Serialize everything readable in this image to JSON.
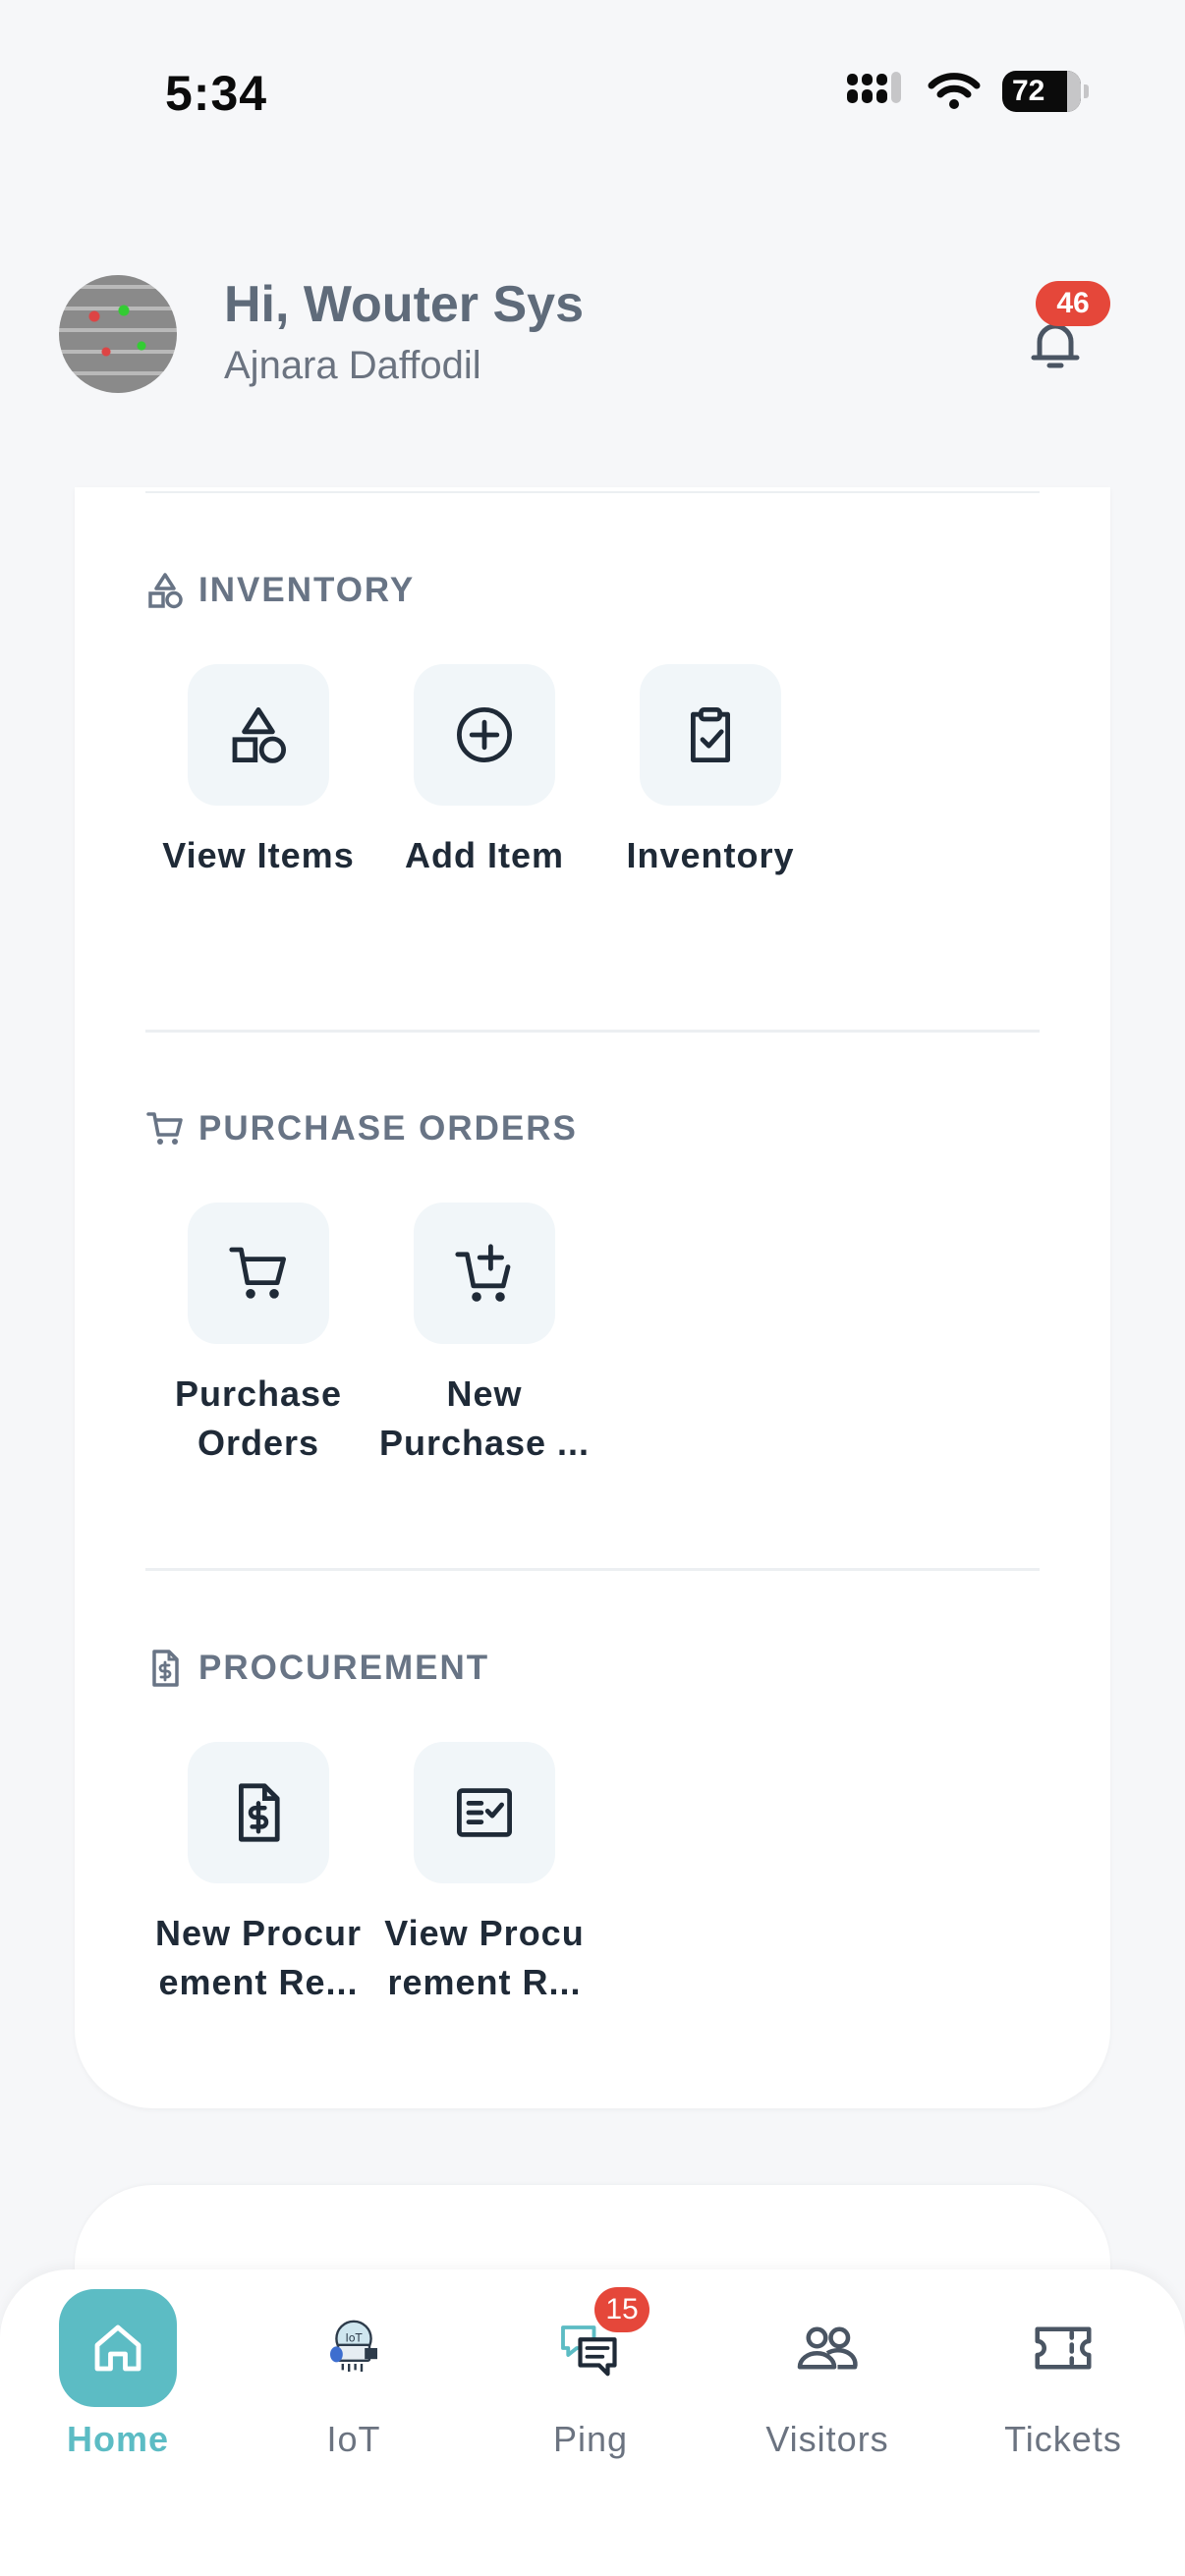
{
  "status_bar": {
    "time": "5:34",
    "battery_level": "72"
  },
  "header": {
    "greeting": "Hi, Wouter Sys",
    "subtitle": "Ajnara Daffodil",
    "notification_count": "46"
  },
  "sections": {
    "inventory": {
      "title": "INVENTORY",
      "items": [
        {
          "label": "View Items",
          "icon": "shapes-icon"
        },
        {
          "label": "Add Item",
          "icon": "plus-circle-icon"
        },
        {
          "label": "Inventory",
          "icon": "clipboard-check-icon"
        }
      ]
    },
    "purchase_orders": {
      "title": "PURCHASE ORDERS",
      "items": [
        {
          "label": "Purchase Orders",
          "icon": "cart-icon"
        },
        {
          "label": "New Purchase ...",
          "icon": "cart-plus-icon"
        }
      ]
    },
    "procurement": {
      "title": "PROCUREMENT",
      "items": [
        {
          "label": "New Procur ement Re...",
          "icon": "file-dollar-icon"
        },
        {
          "label": "View Procu rement R...",
          "icon": "checklist-icon"
        }
      ]
    }
  },
  "bottom_nav": {
    "items": [
      {
        "label": "Home",
        "active": true
      },
      {
        "label": "IoT"
      },
      {
        "label": "Ping",
        "badge": "15"
      },
      {
        "label": "Visitors"
      },
      {
        "label": "Tickets"
      }
    ]
  },
  "colors": {
    "accent": "#5cbcc4",
    "badge": "#e5473a",
    "tile_bg": "#f1f6f9",
    "section_title": "#687485"
  }
}
